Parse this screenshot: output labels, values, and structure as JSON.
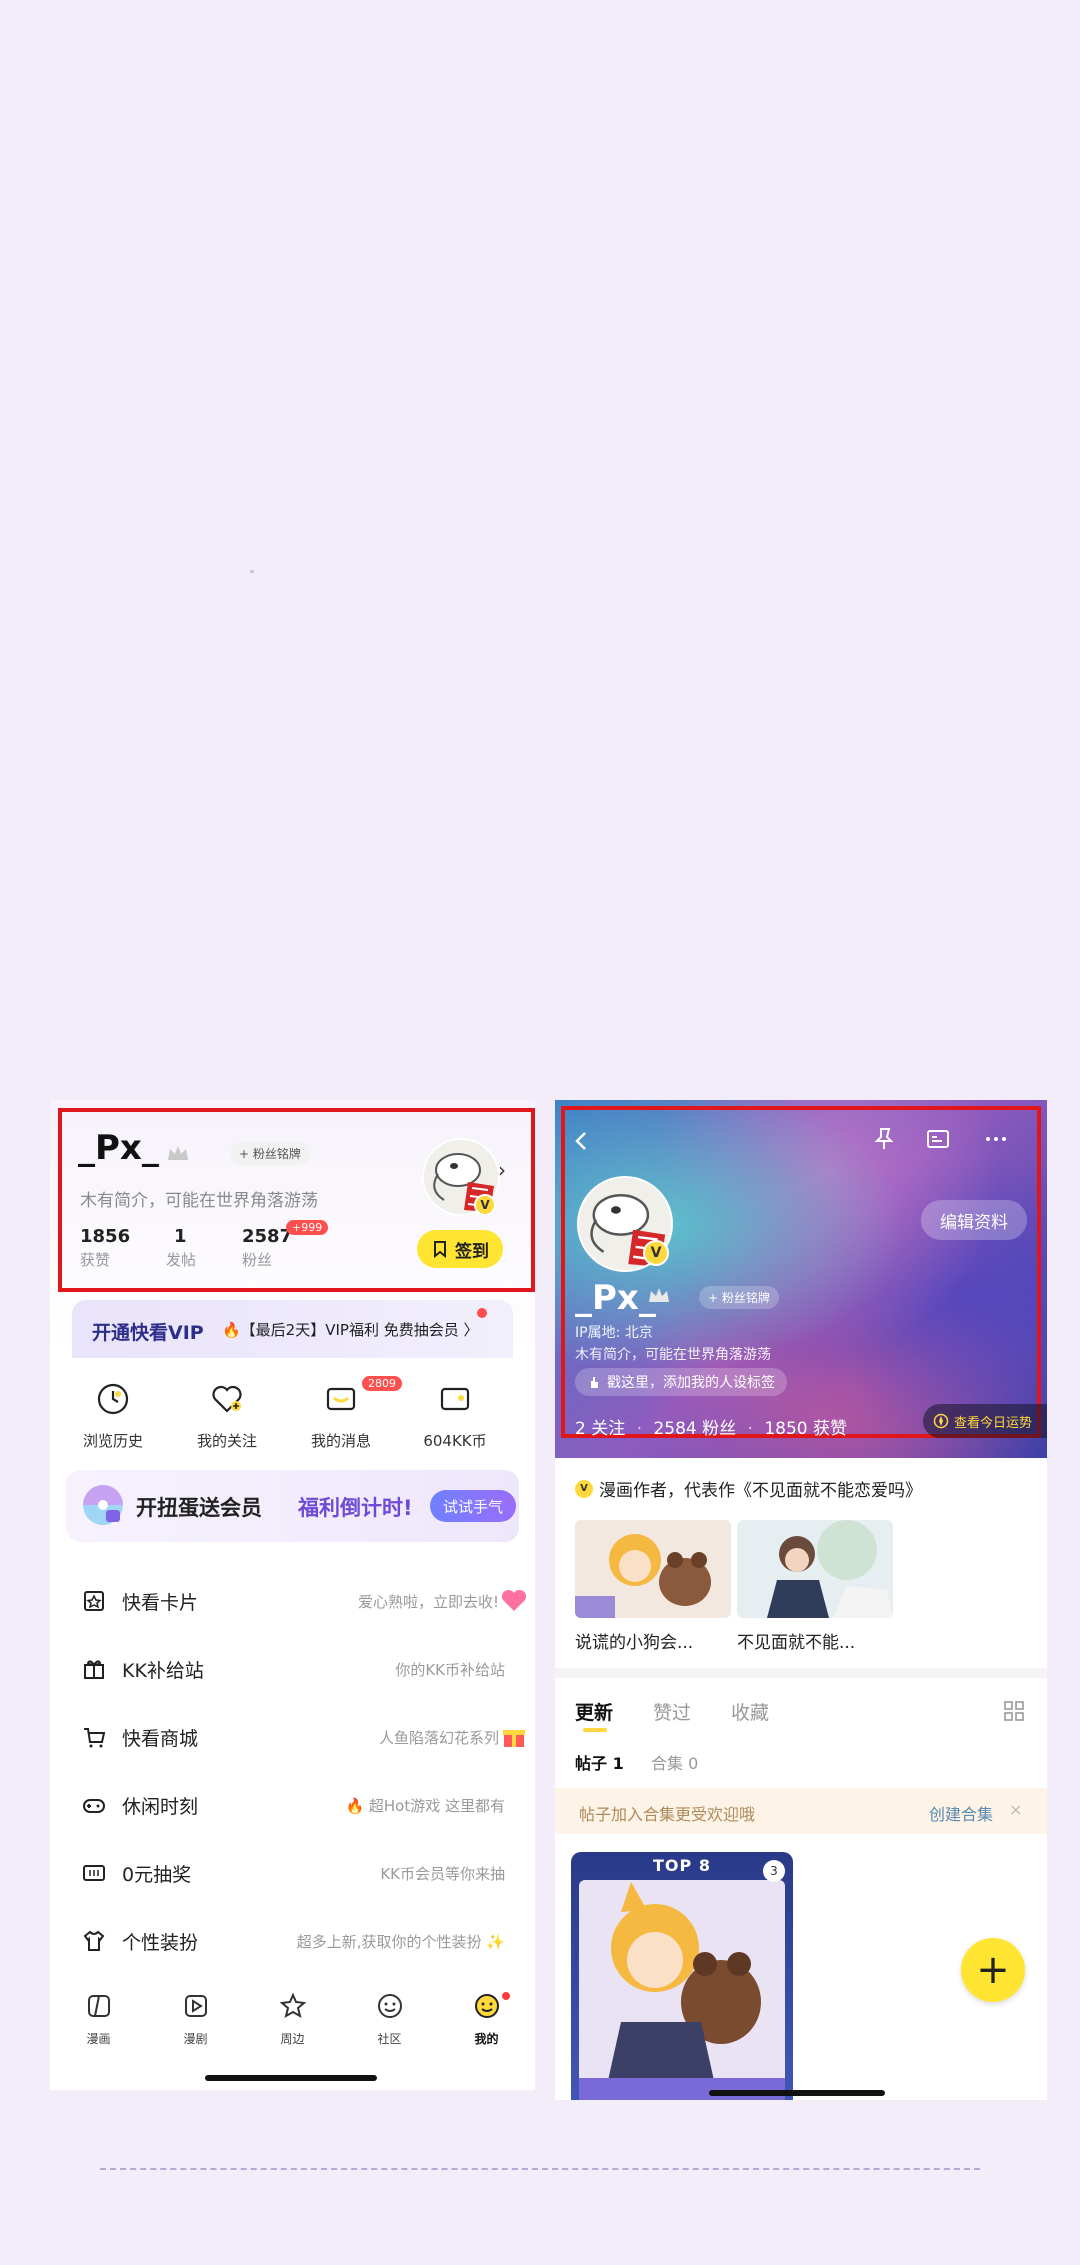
{
  "left_profile": {
    "name": "_Px_",
    "fan_badge": "+ 粉丝铭牌",
    "bio": "木有简介，可能在世界角落游荡",
    "stats": [
      {
        "value": "1856",
        "label": "获赞"
      },
      {
        "value": "1",
        "label": "发帖"
      },
      {
        "value": "2587",
        "label": "粉丝",
        "badge": "+999"
      }
    ],
    "avatar_verified": "V",
    "checkin_label": "签到"
  },
  "vip_bar": {
    "title": "开通快看VIP",
    "promo": "🔥【最后2天】VIP福利 免费抽会员 〉"
  },
  "quick_actions": [
    {
      "label": "浏览历史",
      "icon": "clock-icon"
    },
    {
      "label": "我的关注",
      "icon": "heart-plus-icon"
    },
    {
      "label": "我的消息",
      "icon": "message-icon",
      "badge": "2809"
    },
    {
      "label": "604KK币",
      "icon": "wallet-icon"
    }
  ],
  "egg_banner": {
    "text": "开扭蛋送会员",
    "highlight": "福利倒计时!",
    "button": "试试手气"
  },
  "menu": [
    {
      "label": "快看卡片",
      "right": "爱心熟啦，立即去收!",
      "icon": "card-icon",
      "extra": "heart"
    },
    {
      "label": "KK补给站",
      "right": "你的KK币补给站",
      "icon": "gift-box-icon"
    },
    {
      "label": "快看商城",
      "right": "人鱼陷落幻花系列",
      "icon": "cart-icon",
      "extra": "gift"
    },
    {
      "label": "休闲时刻",
      "right": "🔥 超Hot游戏 这里都有",
      "icon": "gamepad-icon"
    },
    {
      "label": "0元抽奖",
      "right": "KK币会员等你来抽",
      "icon": "ticket-icon"
    },
    {
      "label": "个性装扮",
      "right": "超多上新,获取你的个性装扮 ✨",
      "icon": "shirt-icon"
    }
  ],
  "tabbar": [
    {
      "label": "漫画",
      "icon": "comic-icon"
    },
    {
      "label": "漫剧",
      "icon": "play-icon"
    },
    {
      "label": "周边",
      "icon": "ip-icon"
    },
    {
      "label": "社区",
      "icon": "community-icon"
    },
    {
      "label": "我的",
      "icon": "smiley-icon",
      "active": true
    }
  ],
  "right_profile": {
    "edit_button": "编辑资料",
    "name": "_Px_",
    "fan_badge": "+ 粉丝铭牌",
    "ip_location": "IP属地: 北京",
    "bio": "木有简介，可能在世界角落游荡",
    "tag_pill": "戳这里，添加我的人设标签",
    "follow": "2 关注",
    "fans": "2584 粉丝",
    "likes": "1850 获赞",
    "fortune": "查看今日运势",
    "avatar_verified": "V"
  },
  "works": {
    "title": "漫画作者，代表作《不见面就不能恋爱吗》",
    "items": [
      {
        "label": "说谎的小狗会..."
      },
      {
        "label": "不见面就不能..."
      }
    ]
  },
  "content_tabs": {
    "tabs": [
      "更新",
      "赞过",
      "收藏"
    ],
    "active": "更新",
    "subtabs": [
      "帖子 1",
      "合集 0"
    ]
  },
  "tip_bar": {
    "text": "帖子加入合集更受欢迎哦",
    "link": "创建合集",
    "close": "×"
  },
  "post": {
    "banner": "TOP 8",
    "count": "3"
  },
  "fab_label": "+"
}
